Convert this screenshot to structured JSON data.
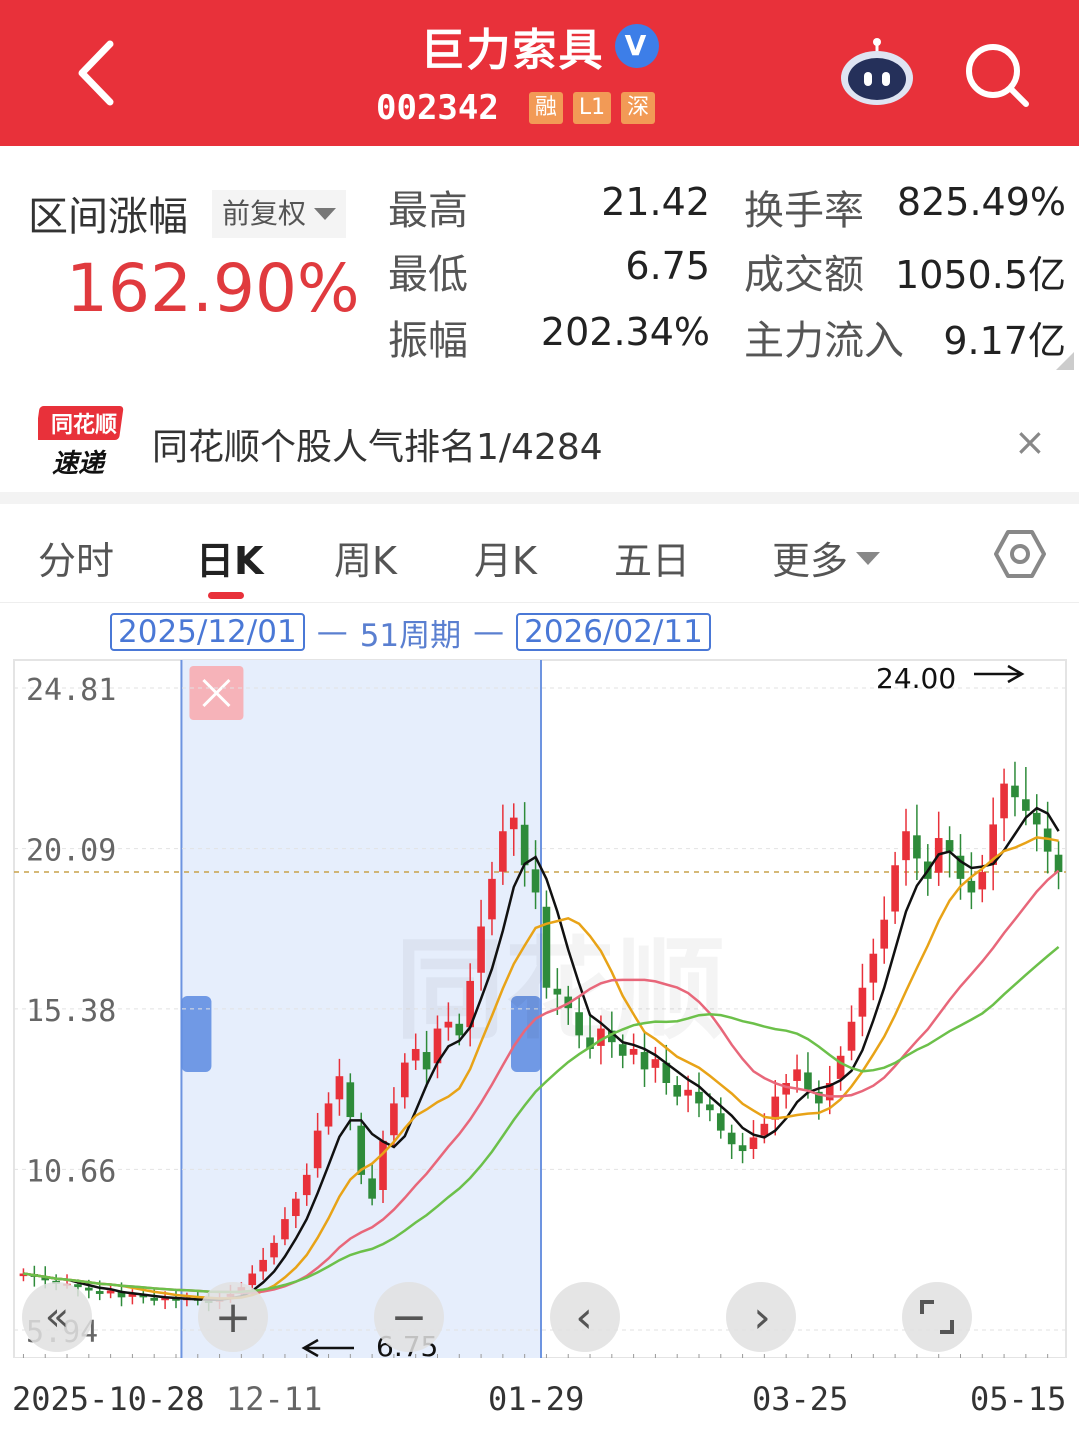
{
  "header": {
    "title": "巨力索具",
    "verified_mark": "V",
    "code": "002342",
    "tags": [
      "融",
      "L1",
      "深"
    ]
  },
  "stats": {
    "range_label": "区间涨幅",
    "adjust_option": "前复权",
    "range_pct": "162.90%",
    "items": [
      {
        "label": "最高",
        "value": "21.42"
      },
      {
        "label": "最低",
        "value": "6.75"
      },
      {
        "label": "振幅",
        "value": "202.34%"
      },
      {
        "label": "换手率",
        "value": "825.49%"
      },
      {
        "label": "成交额",
        "value": "1050.5亿"
      },
      {
        "label": "主力流入",
        "value": "9.17亿"
      }
    ]
  },
  "news": {
    "logo_top": "同花顺",
    "logo_bottom": "速递",
    "text": "同花顺个股人气排名1/4284",
    "close": "×"
  },
  "tabs": [
    "分时",
    "日K",
    "周K",
    "月K",
    "五日",
    "更多"
  ],
  "active_tab": "日K",
  "period": {
    "start": "2025/12/01",
    "middle": "51周期",
    "end": "2026/02/11",
    "dash": "—"
  },
  "chart_data": {
    "type": "candlestick",
    "y_ticks": [
      "24.81",
      "20.09",
      "15.38",
      "10.66",
      "5.94"
    ],
    "ylim": [
      5.94,
      24.81
    ],
    "x_ticks": [
      "2025-10-28",
      "12-11",
      "01-29",
      "03-25",
      "05-15"
    ],
    "annotations": [
      {
        "text": "24.00",
        "arrow": "right"
      },
      {
        "text": "6.75",
        "arrow": "left"
      }
    ],
    "reference_price": 19.4,
    "selection": {
      "start": "2025/12/01",
      "end": "2026/02/11"
    },
    "close_series": [
      7.6,
      7.5,
      7.4,
      7.3,
      7.3,
      7.2,
      7.1,
      7.0,
      7.1,
      6.9,
      7.0,
      6.9,
      6.8,
      6.9,
      6.8,
      6.9,
      6.8,
      6.75,
      6.9,
      7.0,
      7.2,
      7.6,
      8.0,
      8.5,
      9.2,
      9.8,
      10.5,
      11.8,
      12.6,
      13.4,
      12.2,
      10.5,
      9.8,
      11.5,
      12.6,
      13.8,
      14.2,
      13.6,
      14.8,
      15.0,
      14.6,
      16.2,
      17.8,
      19.2,
      20.6,
      21.0,
      19.6,
      18.8,
      16.0,
      15.8,
      15.4,
      14.6,
      14.2,
      14.8,
      14.4,
      14.0,
      14.2,
      13.6,
      13.9,
      13.2,
      12.8,
      13.0,
      12.6,
      12.4,
      11.8,
      11.4,
      11.2,
      11.6,
      12.0,
      12.8,
      13.2,
      13.6,
      13.0,
      12.6,
      13.2,
      14.0,
      15.0,
      16.0,
      17.0,
      18.0,
      19.6,
      20.6,
      19.8,
      19.2,
      20.4,
      20.0,
      19.2,
      18.8,
      19.4,
      20.8,
      22.0,
      21.6,
      21.2,
      20.8,
      20.0,
      19.4
    ],
    "series": [
      {
        "name": "MA5",
        "color": "#111111"
      },
      {
        "name": "MA10",
        "color": "#e8a317"
      },
      {
        "name": "MA20",
        "color": "#e8677a"
      },
      {
        "name": "MA30",
        "color": "#6cc04a"
      }
    ],
    "up_color": "#e8313a",
    "down_color": "#2e8b3a",
    "selection_color": "#e6eefc",
    "watermark": "同花顺"
  },
  "chart_controls": [
    "«",
    "+",
    "−",
    "‹",
    "›",
    "⌜⌟"
  ]
}
